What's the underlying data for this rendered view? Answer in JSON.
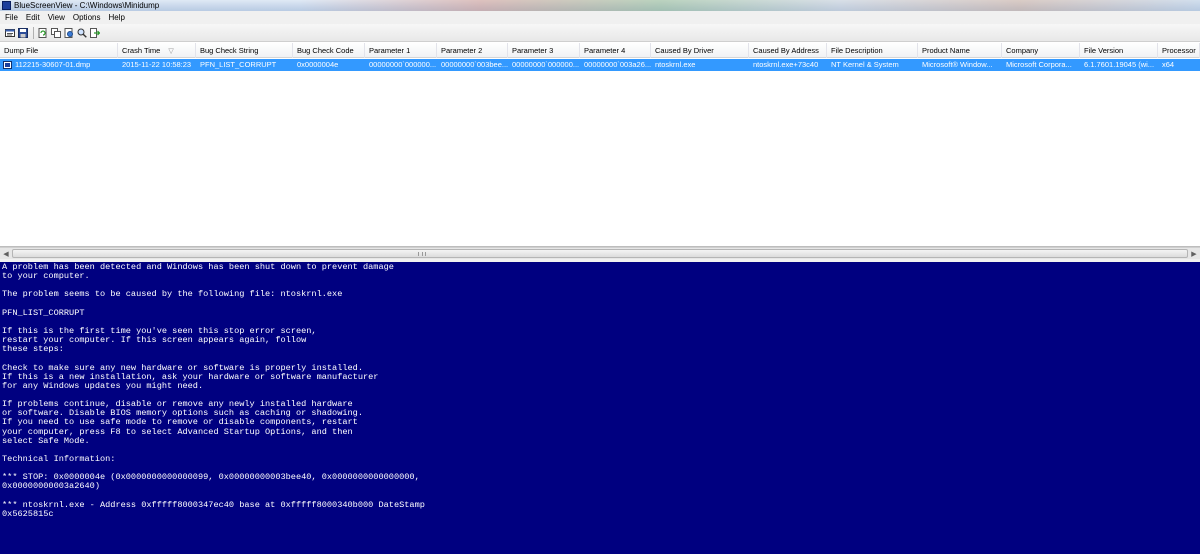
{
  "window": {
    "title": "BlueScreenView  -  C:\\Windows\\Minidump",
    "icon": "bluescreen-app-icon"
  },
  "menu": [
    "File",
    "Edit",
    "View",
    "Options",
    "Help"
  ],
  "toolbar": {
    "buttons": [
      {
        "name": "properties-icon"
      },
      {
        "name": "save-icon"
      },
      {
        "name": "refresh-icon"
      },
      {
        "name": "copy-icon"
      },
      {
        "name": "html-report-icon"
      },
      {
        "name": "find-icon"
      },
      {
        "name": "exit-icon"
      }
    ]
  },
  "table": {
    "columns": [
      "Dump File",
      "Crash Time",
      "Bug Check String",
      "Bug Check Code",
      "Parameter 1",
      "Parameter 2",
      "Parameter 3",
      "Parameter 4",
      "Caused By Driver",
      "Caused By Address",
      "File Description",
      "Product Name",
      "Company",
      "File Version",
      "Processor"
    ],
    "sort_indicator": "▽",
    "rows": [
      [
        "112215-30607-01.dmp",
        "2015-11-22 10:58:23",
        "PFN_LIST_CORRUPT",
        "0x0000004e",
        "00000000`000000...",
        "00000000`003bee...",
        "00000000`000000...",
        "00000000`003a26...",
        "ntoskrnl.exe",
        "ntoskrnl.exe+73c40",
        "NT Kernel & System",
        "Microsoft® Window...",
        "Microsoft Corpora...",
        "6.1.7601.19045 (wi...",
        "x64"
      ]
    ],
    "selected_row_color": "#3399ff"
  },
  "bsod": {
    "background": "#000080",
    "lines": [
      "A problem has been detected and Windows has been shut down to prevent damage",
      "to your computer.",
      "",
      "The problem seems to be caused by the following file: ntoskrnl.exe",
      "",
      "PFN_LIST_CORRUPT",
      "",
      "If this is the first time you've seen this stop error screen,",
      "restart your computer. If this screen appears again, follow",
      "these steps:",
      "",
      "Check to make sure any new hardware or software is properly installed.",
      "If this is a new installation, ask your hardware or software manufacturer",
      "for any Windows updates you might need.",
      "",
      "If problems continue, disable or remove any newly installed hardware",
      "or software. Disable BIOS memory options such as caching or shadowing.",
      "If you need to use safe mode to remove or disable components, restart",
      "your computer, press F8 to select Advanced Startup Options, and then",
      "select Safe Mode.",
      "",
      "Technical Information:",
      "",
      "*** STOP: 0x0000004e (0x0000000000000099, 0x00000000003bee40, 0x0000000000000000,",
      "0x00000000003a2640)",
      "",
      "*** ntoskrnl.exe - Address 0xfffff8000347ec40 base at 0xfffff8000340b000 DateStamp",
      "0x5625815c"
    ]
  }
}
